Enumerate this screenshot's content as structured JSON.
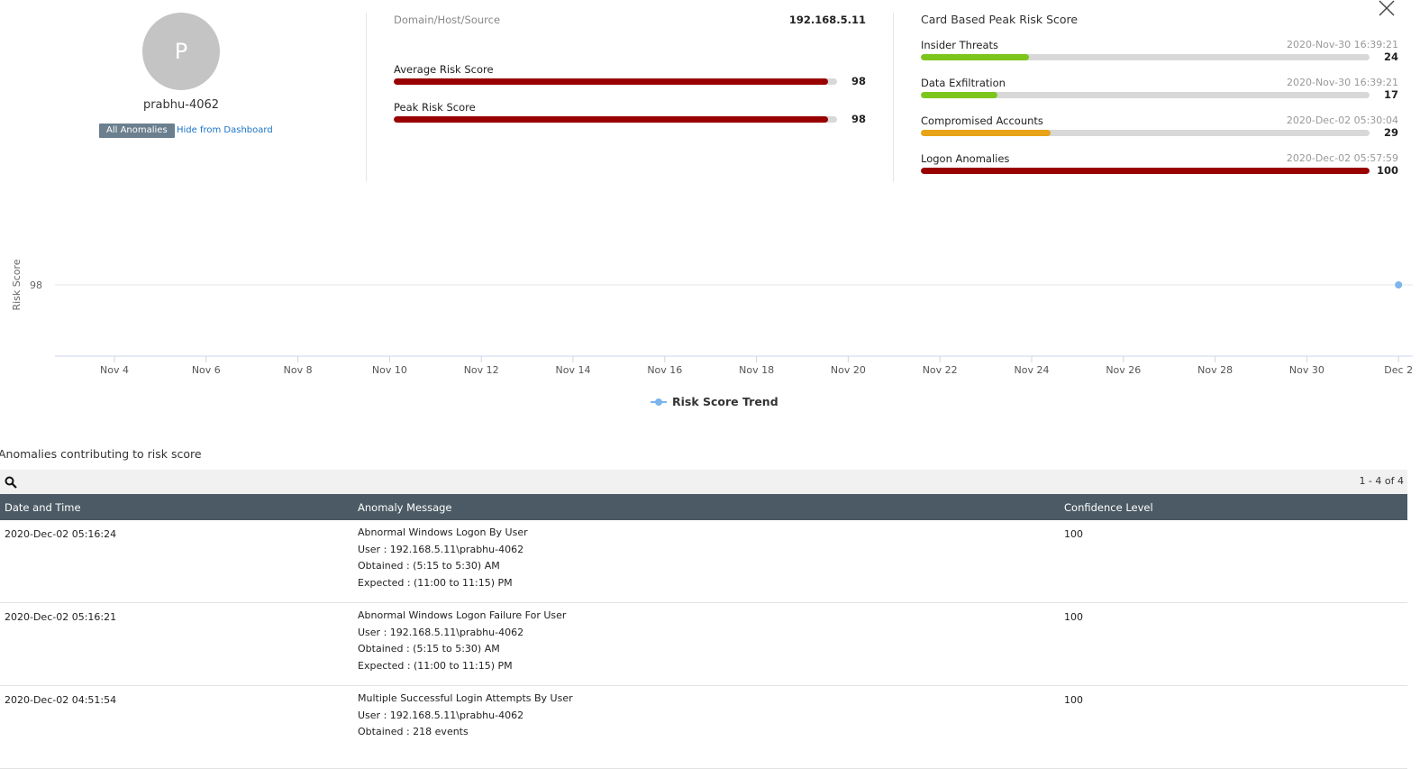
{
  "profile": {
    "avatar_letter": "P",
    "username": "prabhu-4062",
    "all_anomalies_label": "All Anomalies",
    "hide_label": "Hide from Dashboard"
  },
  "summary": {
    "domain_label": "Domain/Host/Source",
    "domain_value": "192.168.5.11",
    "metrics": [
      {
        "label": "Average Risk Score",
        "value": "98",
        "fraction": 0.98
      },
      {
        "label": "Peak Risk Score",
        "value": "98",
        "fraction": 0.98
      }
    ]
  },
  "cards": {
    "title": "Card Based Peak Risk Score",
    "items": [
      {
        "label": "Insider Threats",
        "date": "2020-Nov-30 16:39:21",
        "value": "24",
        "fraction": 0.24,
        "color": "#7cc61b"
      },
      {
        "label": "Data Exfiltration",
        "date": "2020-Nov-30 16:39:21",
        "value": "17",
        "fraction": 0.17,
        "color": "#7cc61b"
      },
      {
        "label": "Compromised Accounts",
        "date": "2020-Dec-02 05:30:04",
        "value": "29",
        "fraction": 0.29,
        "color": "#e8a317"
      },
      {
        "label": "Logon Anomalies",
        "date": "2020-Dec-02 05:57:59",
        "value": "100",
        "fraction": 1.0,
        "color": "#990000"
      }
    ]
  },
  "chart_data": {
    "type": "line",
    "ylabel": "Risk Score",
    "yticks": [
      "98"
    ],
    "xticks": [
      "Nov 4",
      "Nov 6",
      "Nov 8",
      "Nov 10",
      "Nov 12",
      "Nov 14",
      "Nov 16",
      "Nov 18",
      "Nov 20",
      "Nov 22",
      "Nov 24",
      "Nov 26",
      "Nov 28",
      "Nov 30",
      "Dec 2"
    ],
    "series": [
      {
        "name": "Risk Score Trend",
        "color": "#7cb5ec",
        "points": [
          {
            "x": "Dec 2",
            "y": 98
          }
        ]
      }
    ],
    "legend": "bottom-center"
  },
  "anomalies": {
    "title": "Anomalies contributing to risk score",
    "pager": "1 - 4 of 4",
    "columns": [
      "Date and Time",
      "Anomaly Message",
      "Confidence Level"
    ],
    "rows": [
      {
        "datetime": "2020-Dec-02 05:16:24",
        "lines": [
          "Abnormal Windows Logon By User",
          "User : 192.168.5.11\\prabhu-4062",
          "Obtained : (5:15 to 5:30) AM",
          "Expected : (11:00 to 11:15) PM"
        ],
        "confidence": "100"
      },
      {
        "datetime": "2020-Dec-02 05:16:21",
        "lines": [
          "Abnormal Windows Logon Failure For User",
          "User : 192.168.5.11\\prabhu-4062",
          "Obtained : (5:15 to 5:30) AM",
          "Expected : (11:00 to 11:15) PM"
        ],
        "confidence": "100"
      },
      {
        "datetime": "2020-Dec-02 04:51:54",
        "lines": [
          "Multiple Successful Login Attempts By User",
          "User : 192.168.5.11\\prabhu-4062",
          "Obtained : 218 events"
        ],
        "confidence": "100"
      }
    ]
  }
}
